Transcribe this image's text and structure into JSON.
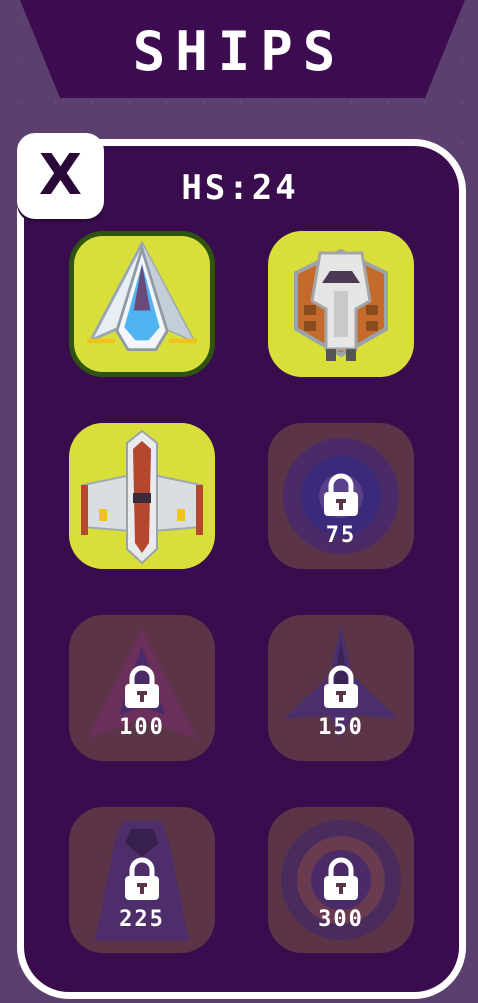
{
  "header": {
    "title": "SHIPS"
  },
  "close_label": "X",
  "high_score": "HS:24",
  "ships": [
    {
      "status": "selected",
      "price": ""
    },
    {
      "status": "unlocked",
      "price": ""
    },
    {
      "status": "unlocked",
      "price": ""
    },
    {
      "status": "locked",
      "price": "75"
    },
    {
      "status": "locked",
      "price": "100"
    },
    {
      "status": "locked",
      "price": "150"
    },
    {
      "status": "locked",
      "price": "225"
    },
    {
      "status": "locked",
      "price": "300"
    }
  ],
  "colors": {
    "background": "#5a3f6f",
    "panel": "#380c4d",
    "unlocked_tile": "#d8df3a",
    "locked_tile": "#5b3547",
    "selected_border": "#2e5410"
  },
  "icons": [
    "close-icon",
    "lock-icon"
  ]
}
